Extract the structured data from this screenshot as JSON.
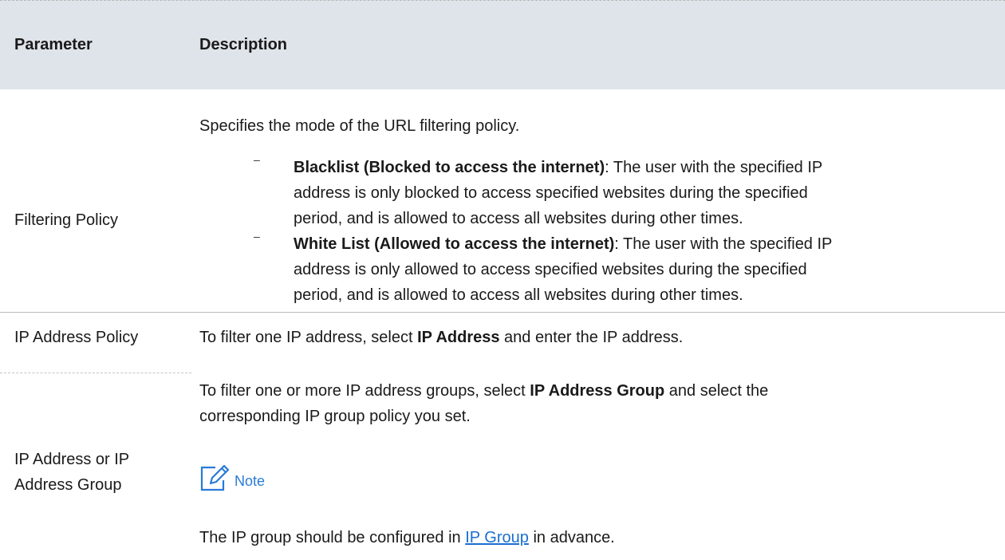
{
  "table": {
    "header": {
      "parameter": "Parameter",
      "description": "Description"
    },
    "rows": [
      {
        "parameter": "Filtering Policy",
        "intro": "Specifies the mode of the URL filtering policy.",
        "bullets": [
          {
            "term": "Blacklist (Blocked to access the internet)",
            "line1": ": The user with the specified IP",
            "line2": "address is only blocked to access specified websites during the specified",
            "line3": "period, and is allowed to access all websites during other times."
          },
          {
            "term": "White List (Allowed to access the internet)",
            "line1": ": The user with the specified IP",
            "line2": "address is only allowed to access specified websites during the specified",
            "line3": "period, and is allowed to access all websites during other times."
          }
        ]
      },
      {
        "parameter": "IP Address Policy",
        "pre": "To filter one IP address, select ",
        "bold": "IP Address",
        "post": " and enter the IP address."
      },
      {
        "parameter_line1": "IP Address or IP",
        "parameter_line2": "Address Group",
        "pre": "To filter one or more IP address groups, select ",
        "bold": "IP Address Group",
        "post": " and select the",
        "line2": "corresponding IP group policy you set.",
        "note_label": "Note",
        "note_pre": "The IP group should be configured in ",
        "note_link": "IP Group",
        "note_post": " in advance."
      }
    ]
  },
  "colors": {
    "header_bg": "#dfe4ea",
    "link": "#1a6fd0",
    "note_accent": "#2a7ad8"
  }
}
